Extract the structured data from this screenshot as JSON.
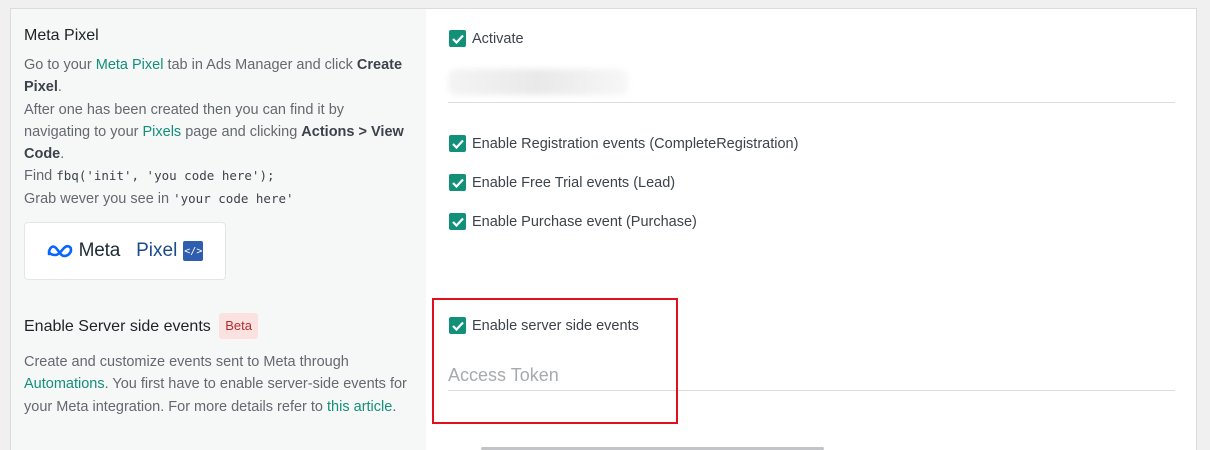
{
  "left": {
    "pixel_section": {
      "title": "Meta Pixel",
      "desc": {
        "p1": "Go to your ",
        "link_meta_pixel": "Meta Pixel",
        "p2": " tab in Ads Manager and click ",
        "create_pixel": "Create Pixel",
        "p3": ".",
        "p4": "After one has been created then you can find it by navigating to your ",
        "link_pixels": "Pixels",
        "p5": " page and clicking ",
        "actions": "Actions >",
        "view_code": "View Code",
        "p6": ".",
        "find_label": "Find ",
        "find_code": "fbq('init', 'you code here');",
        "grab_label": "Grab wever you see in ",
        "grab_code": "'your code here'"
      },
      "logo": {
        "meta_word": "Meta",
        "pixel_word": "Pixel",
        "code_badge": "</>"
      }
    },
    "server_section": {
      "title": "Enable Server side events",
      "badge": "Beta",
      "desc": {
        "p1": "Create and customize events sent to Meta through ",
        "link_automations": "Automations",
        "p2": ". You first have to enable server-side events for your Meta integration. For more details refer to ",
        "link_article": "this article",
        "p3": "."
      }
    }
  },
  "right": {
    "activate_label": "Activate",
    "events": [
      "Enable Registration events (CompleteRegistration)",
      "Enable Free Trial events (Lead)",
      "Enable Purchase event (Purchase)"
    ],
    "server_events_label": "Enable server side events",
    "access_token_placeholder": "Access Token"
  },
  "colors": {
    "accent": "#13907a",
    "highlight": "#e20f1f",
    "beta_bg": "#fce1e1",
    "beta_text": "#b32d2e"
  }
}
